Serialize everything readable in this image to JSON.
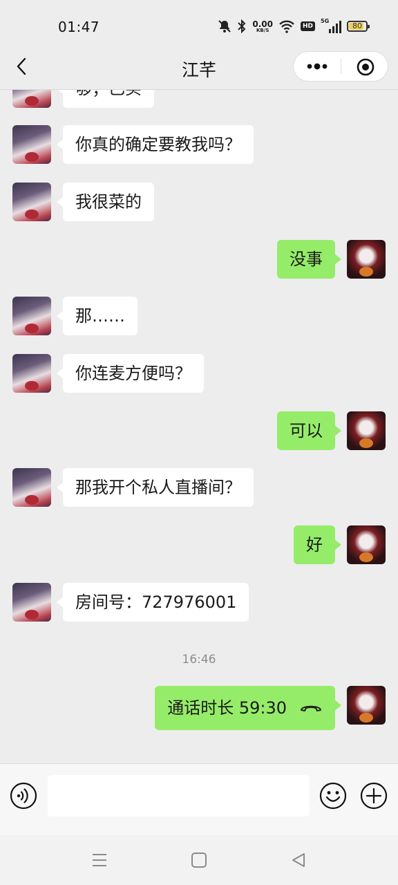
{
  "status": {
    "time": "01:47",
    "net_speed_value": "0.00",
    "net_speed_unit": "KB/S",
    "hd_label": "HD",
    "signal_label": "5G",
    "battery": "80"
  },
  "header": {
    "title": "江芊",
    "back_icon": "chevron-left-icon",
    "more_icon": "more-dots-icon",
    "close_icon": "target-circle-icon"
  },
  "messages": [
    {
      "side": "in",
      "text": "够；已买"
    },
    {
      "side": "in",
      "text": "你真的确定要教我吗？"
    },
    {
      "side": "in",
      "text": "我很菜的"
    },
    {
      "side": "out",
      "text": "没事"
    },
    {
      "side": "in",
      "text": "那……"
    },
    {
      "side": "in",
      "text": "你连麦方便吗？"
    },
    {
      "side": "out",
      "text": "可以"
    },
    {
      "side": "in",
      "text": "那我开个私人直播间？"
    },
    {
      "side": "out",
      "text": "好"
    },
    {
      "side": "in",
      "text": "房间号：727976001"
    }
  ],
  "timestamp": "16:46",
  "call": {
    "label": "通话时长 59:30",
    "icon": "hangup-phone-icon"
  },
  "input": {
    "value": "",
    "placeholder": ""
  },
  "icons": {
    "voice": "voice-icon",
    "emoji": "emoji-icon",
    "plus": "plus-icon"
  },
  "system_nav": [
    "menu-icon",
    "home-icon",
    "back-triangle-icon"
  ],
  "colors": {
    "background": "#ededed",
    "outgoing_bubble": "#95ec69",
    "incoming_bubble": "#ffffff",
    "timestamp": "#8c8c8c",
    "battery": "#f1d05a"
  }
}
